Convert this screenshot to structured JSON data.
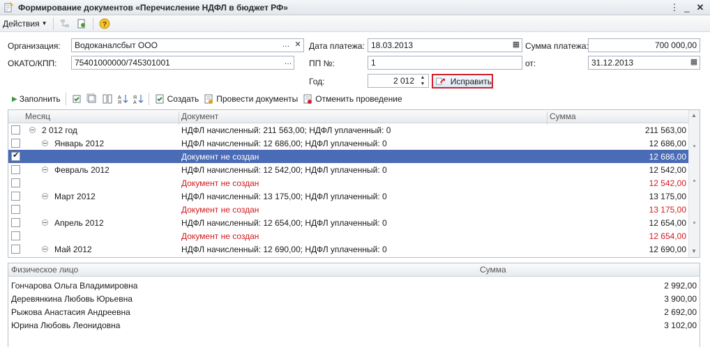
{
  "window": {
    "title": "Формирование документов «Перечисление НДФЛ в бюджет РФ»"
  },
  "toolbar": {
    "actions_label": "Действия"
  },
  "form": {
    "organization_label": "Организация:",
    "organization_value": "Водоканалсбыт ООО",
    "okato_label": "ОКАТО/КПП:",
    "okato_value": "75401000000/745301001",
    "payment_date_label": "Дата платежа:",
    "payment_date_value": "18.03.2013",
    "pp_label": "ПП №:",
    "pp_value": "1",
    "year_label": "Год:",
    "year_value": "2 012",
    "amount_label": "Сумма платежа:",
    "amount_value": "700 000,00",
    "from_label": "от:",
    "from_value": "31.12.2013",
    "fix_button": "Исправить"
  },
  "toolbar2": {
    "fill": "Заполнить",
    "create": "Создать",
    "post_docs": "Провести документы",
    "cancel_posting": "Отменить проведение"
  },
  "grid": {
    "headers": {
      "month": "Месяц",
      "document": "Документ",
      "sum": "Сумма"
    },
    "rows": [
      {
        "checked": false,
        "tree": true,
        "month": "2 012 год",
        "document": "НДФЛ начисленный: 211 563,00; НДФЛ уплаченный: 0",
        "sum": "211 563,00",
        "red": false
      },
      {
        "checked": false,
        "tree": true,
        "month": "Январь 2012",
        "document": "НДФЛ начисленный: 12 686,00; НДФЛ уплаченный: 0",
        "sum": "12 686,00",
        "red": false
      },
      {
        "checked": true,
        "tree": false,
        "month": "",
        "document": "Документ не создан",
        "sum": "12 686,00",
        "red": false,
        "selected": true
      },
      {
        "checked": false,
        "tree": true,
        "month": "Февраль 2012",
        "document": "НДФЛ начисленный: 12 542,00; НДФЛ уплаченный: 0",
        "sum": "12 542,00",
        "red": false
      },
      {
        "checked": false,
        "tree": false,
        "month": "",
        "document": "Документ не создан",
        "sum": "12 542,00",
        "red": true
      },
      {
        "checked": false,
        "tree": true,
        "month": "Март 2012",
        "document": "НДФЛ начисленный: 13 175,00; НДФЛ уплаченный: 0",
        "sum": "13 175,00",
        "red": false
      },
      {
        "checked": false,
        "tree": false,
        "month": "",
        "document": "Документ не создан",
        "sum": "13 175,00",
        "red": true
      },
      {
        "checked": false,
        "tree": true,
        "month": "Апрель 2012",
        "document": "НДФЛ начисленный: 12 654,00; НДФЛ уплаченный: 0",
        "sum": "12 654,00",
        "red": false
      },
      {
        "checked": false,
        "tree": false,
        "month": "",
        "document": "Документ не создан",
        "sum": "12 654,00",
        "red": true
      },
      {
        "checked": false,
        "tree": true,
        "month": "Май 2012",
        "document": "НДФЛ начисленный: 12 690,00; НДФЛ уплаченный: 0",
        "sum": "12 690,00",
        "red": false
      }
    ]
  },
  "persons": {
    "headers": {
      "person": "Физическое лицо",
      "sum": "Сумма"
    },
    "rows": [
      {
        "name": "Гончарова Ольга Владимировна",
        "sum": "2 992,00"
      },
      {
        "name": "Деревянкина Любовь Юрьевна",
        "sum": "3 900,00"
      },
      {
        "name": "Рыжова Анастасия Андреевна",
        "sum": "2 692,00"
      },
      {
        "name": "Юрина Любовь Леонидовна",
        "sum": "3 102,00"
      }
    ]
  },
  "colors": {
    "selection": "#4a6bb5",
    "error_text": "#d1191f",
    "highlight_border": "#d0202a"
  }
}
